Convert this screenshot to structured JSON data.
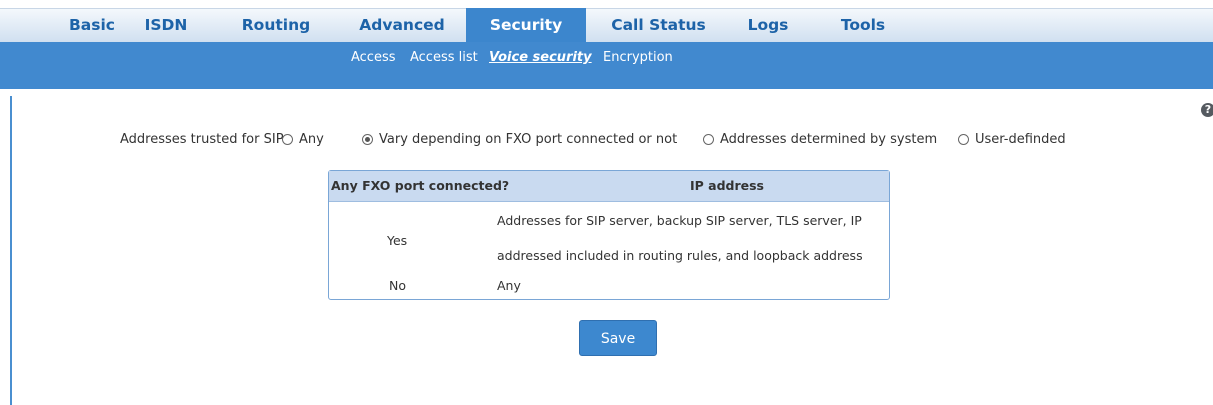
{
  "nav": {
    "items": [
      {
        "label": "Basic"
      },
      {
        "label": "ISDN"
      },
      {
        "label": "Routing"
      },
      {
        "label": "Advanced"
      },
      {
        "label": "Security"
      },
      {
        "label": "Call Status"
      },
      {
        "label": "Logs"
      },
      {
        "label": "Tools"
      }
    ],
    "active": "Security"
  },
  "subnav": {
    "items": [
      {
        "label": "Access"
      },
      {
        "label": "Access list"
      },
      {
        "label": "Voice security"
      },
      {
        "label": "Encryption"
      }
    ],
    "active": "Voice security"
  },
  "help": {
    "symbol": "?"
  },
  "trusted": {
    "label": "Addresses trusted for SIP",
    "options": [
      {
        "label": "Any",
        "checked": false
      },
      {
        "label": "Vary depending on FXO port connected or not",
        "checked": true
      },
      {
        "label": "Addresses determined by system",
        "checked": false
      },
      {
        "label": "User-definded",
        "checked": false
      }
    ]
  },
  "table": {
    "headers": [
      "Any FXO port connected?",
      "IP address"
    ],
    "rows": [
      {
        "connected": "Yes",
        "address_line1": "Addresses for SIP server, backup SIP server, TLS server, IP",
        "address_line2": "addressed included in routing rules, and loopback address"
      },
      {
        "connected": "No",
        "address_line1": "Any"
      }
    ]
  },
  "save": {
    "label": "Save"
  },
  "colors": {
    "accent": "#3c86cd",
    "nav_text": "#1d63a8",
    "subbar": "#4189cf"
  }
}
